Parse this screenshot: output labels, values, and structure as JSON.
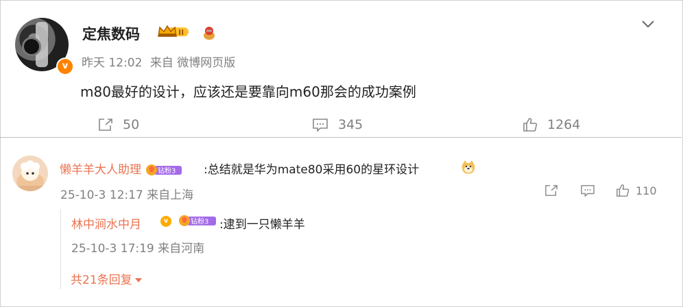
{
  "post": {
    "author": "定焦数码",
    "time": "昨天 12:02",
    "source": "来自 微博网页版",
    "text": "m80最好的设计，应该还是要靠向m60那会的成功案例",
    "share_count": "50",
    "comment_count": "345",
    "like_count": "1264",
    "badge_level": "II"
  },
  "comment": {
    "author": "懒羊羊大人助理",
    "fan_badge": "钻粉3",
    "text": ":总结就是华为mate80采用60的星环设计",
    "time": "25-10-3 12:17",
    "location": "来自上海",
    "like_count": "110"
  },
  "reply": {
    "author": "林中涧水中月",
    "fan_badge": "钻粉3",
    "text": ":逮到一只懒羊羊",
    "time": "25-10-3 17:19",
    "location": "来自河南",
    "more_label": "共21条回复"
  },
  "colors": {
    "accent": "#eb7350",
    "verified": "#ff8200",
    "muted": "#808080"
  }
}
